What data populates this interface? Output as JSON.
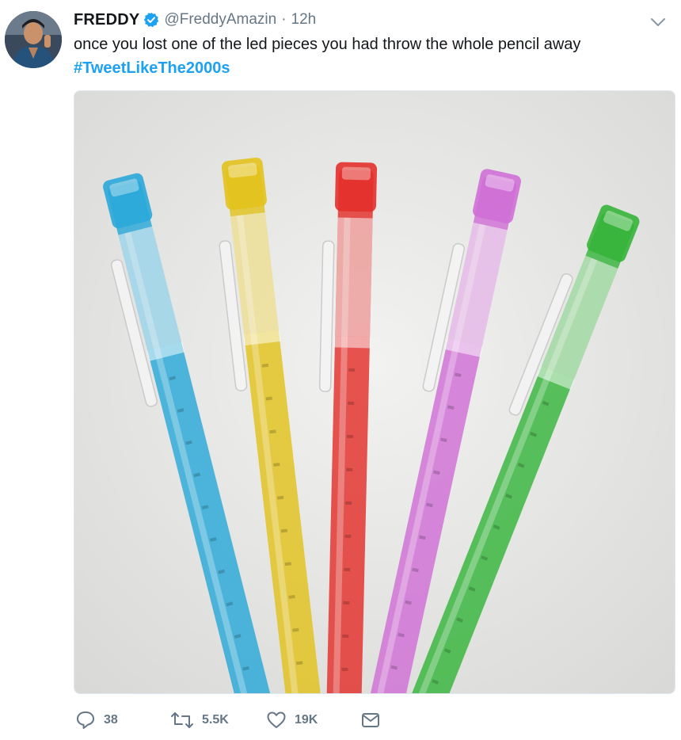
{
  "author": {
    "display_name": "FREDDY",
    "handle": "@FreddyAmazin",
    "separator": "·",
    "time": "12h",
    "verified": true,
    "avatar_icon": "profile-photo"
  },
  "tweet": {
    "text": "once you lost one of the led pieces you had throw the whole pencil away",
    "hashtag": "#TweetLikeThe2000s",
    "hashtag_color": "#1da1f2"
  },
  "media": {
    "kind": "photo",
    "subject_colors": [
      "#2aa8d8",
      "#e2c21c",
      "#e3302b",
      "#cf6fd6",
      "#36b43a"
    ]
  },
  "actions": {
    "reply": {
      "icon": "reply-icon",
      "count": "38"
    },
    "retweet": {
      "icon": "retweet-icon",
      "count": "5.5K"
    },
    "like": {
      "icon": "heart-icon",
      "count": "19K"
    },
    "message": {
      "icon": "envelope-icon"
    }
  },
  "menu": {
    "icon": "chevron-down-icon"
  },
  "colors": {
    "text": "#14171a",
    "secondary": "#657786",
    "accent": "#1da1f2",
    "verified": "#1da1f2"
  }
}
